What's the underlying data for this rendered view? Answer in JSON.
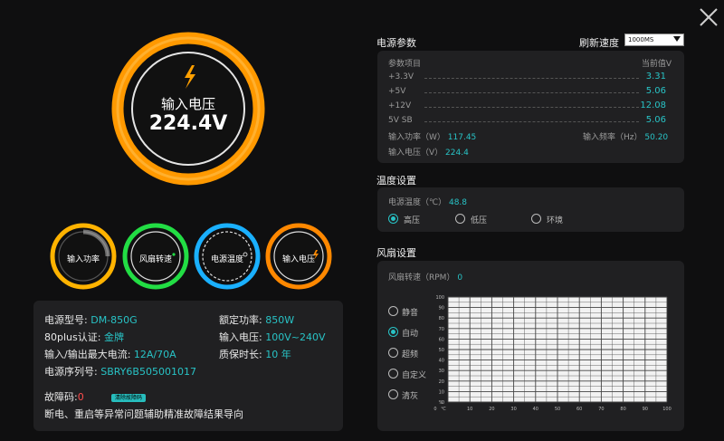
{
  "window": {
    "close_icon": "close-icon"
  },
  "gauge": {
    "label": "输入电压",
    "value": "224.4V",
    "color": "#ff9900",
    "bolt_icon": "lightning-icon"
  },
  "small_gauges": [
    {
      "label": "输入功率",
      "color": "#ffb300"
    },
    {
      "label": "风扇转速",
      "color": "#22dd44"
    },
    {
      "label": "电源温度",
      "color": "#1ab0ff"
    },
    {
      "label": "输入电压",
      "color": "#ff8800"
    }
  ],
  "info": {
    "model_label": "电源型号:",
    "model_value": "DM-850G",
    "rated_label": "额定功率:",
    "rated_value": "850W",
    "cert_label": "80plus认证:",
    "cert_value": "金牌",
    "input_label": "输入电压:",
    "input_value": "100V~240V",
    "current_label": "输入/输出最大电流:",
    "current_value": "12A/70A",
    "warranty_label": "质保时长:",
    "warranty_value": "10 年",
    "serial_label": "电源序列号:",
    "serial_value": "SBRY6B505001017",
    "fault_label": "故障码:",
    "fault_value": "0",
    "fault_badge": "清除故障码",
    "fault_desc": "断电、重启等异常问题辅助精准故障结果导向"
  },
  "params": {
    "title": "电源参数",
    "refresh_label": "刷新速度",
    "refresh_value": "1000MS",
    "col_item": "参数项目",
    "col_value": "当前值V",
    "rows": [
      {
        "name": "+3.3V",
        "value": "3.31"
      },
      {
        "name": "+5V",
        "value": "5.06"
      },
      {
        "name": "+12V",
        "value": "12.08"
      },
      {
        "name": "5V SB",
        "value": "5.06"
      }
    ],
    "power_label": "输入功率（W）",
    "power_value": "117.45",
    "freq_label": "输入频率（Hz）",
    "freq_value": "50.20",
    "volt_label": "输入电压（V）",
    "volt_value": "224.4"
  },
  "temp": {
    "title": "温度设置",
    "label": "电源温度（℃）",
    "value": "48.8",
    "options": [
      "高压",
      "低压",
      "环境"
    ],
    "selected": 0
  },
  "fan": {
    "title": "风扇设置",
    "label": "风扇转速（RPM）",
    "value": "0",
    "modes": [
      "静音",
      "自动",
      "超频",
      "自定义",
      "清灰"
    ],
    "selected": 1,
    "y_unit": "%",
    "x_unit": "℃",
    "ticks": [
      "0",
      "10",
      "20",
      "30",
      "40",
      "50",
      "60",
      "70",
      "80",
      "90",
      "100"
    ]
  }
}
